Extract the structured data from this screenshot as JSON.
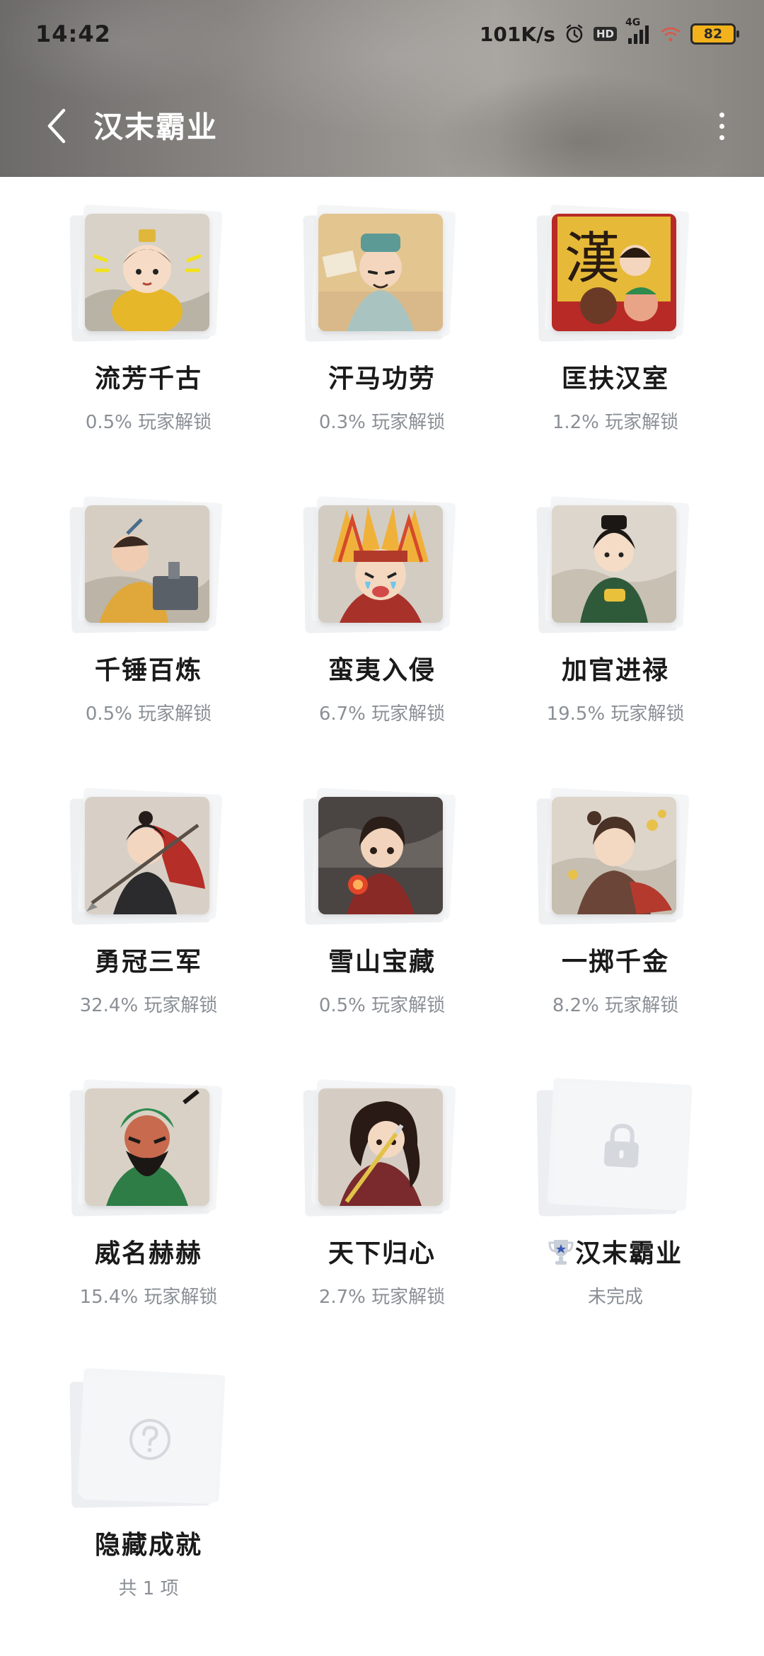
{
  "status_bar": {
    "time": "14:42",
    "net_speed": "101K/s",
    "hd": "HD",
    "network": "4G",
    "battery": "82"
  },
  "nav": {
    "title": "汉末霸业"
  },
  "achievements": [
    {
      "title": "流芳千古",
      "subtitle": "0.5% 玩家解锁",
      "art": "emperor-portrait"
    },
    {
      "title": "汗马功劳",
      "subtitle": "0.3% 玩家解锁",
      "art": "scholar-portrait"
    },
    {
      "title": "匡扶汉室",
      "subtitle": "1.2% 玩家解锁",
      "art": "han-banner-portrait"
    },
    {
      "title": "千锤百炼",
      "subtitle": "0.5% 玩家解锁",
      "art": "blacksmith-portrait"
    },
    {
      "title": "蛮夷入侵",
      "subtitle": "6.7% 玩家解锁",
      "art": "barbarian-portrait"
    },
    {
      "title": "加官进禄",
      "subtitle": "19.5% 玩家解锁",
      "art": "official-portrait"
    },
    {
      "title": "勇冠三军",
      "subtitle": "32.4% 玩家解锁",
      "art": "spear-warrior-portrait"
    },
    {
      "title": "雪山宝藏",
      "subtitle": "0.5% 玩家解锁",
      "art": "treasure-hunter-portrait"
    },
    {
      "title": "一掷千金",
      "subtitle": "8.2% 玩家解锁",
      "art": "gold-coins-portrait"
    },
    {
      "title": "威名赫赫",
      "subtitle": "15.4% 玩家解锁",
      "art": "guan-yu-portrait"
    },
    {
      "title": "天下归心",
      "subtitle": "2.7% 玩家解锁",
      "art": "sword-lady-portrait"
    },
    {
      "title": "汉末霸业",
      "subtitle": "未完成",
      "art": "lock-icon",
      "trophy": true
    },
    {
      "title": "隐藏成就",
      "subtitle": "共 1 项",
      "art": "question-icon"
    }
  ]
}
